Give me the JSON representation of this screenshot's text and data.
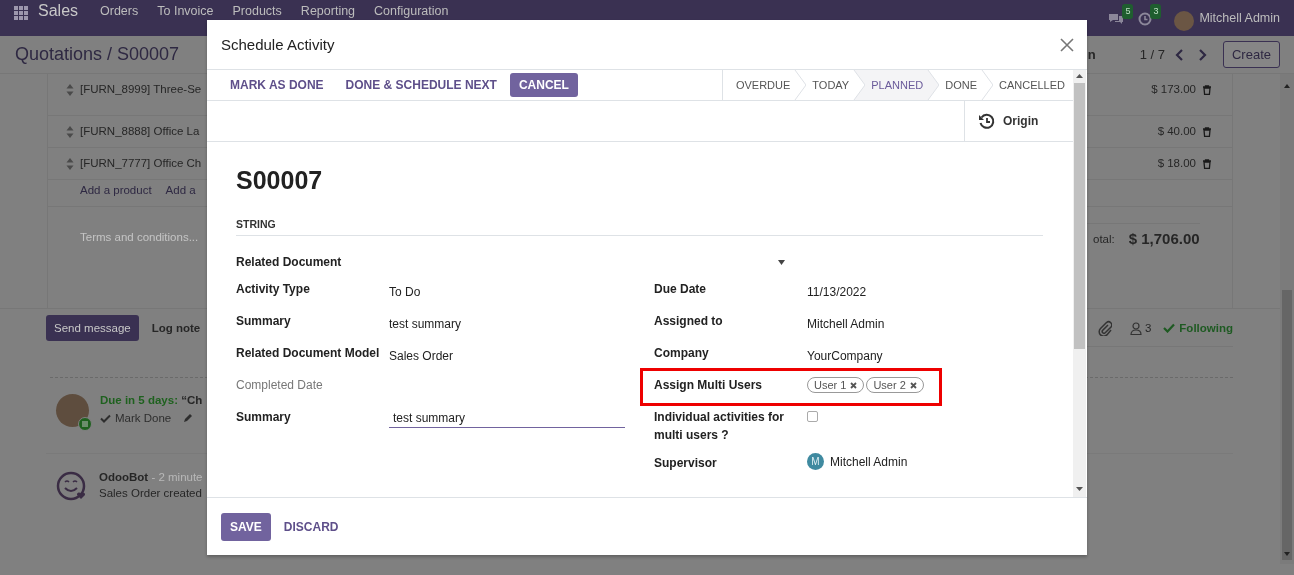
{
  "navbar": {
    "app": "Sales",
    "menu": [
      "Orders",
      "To Invoice",
      "Products",
      "Reporting",
      "Configuration"
    ],
    "messages_count": "5",
    "activities_count": "3",
    "user": "Mitchell Admin"
  },
  "control_panel": {
    "breadcrumb": "Quotations / S00007",
    "action_fragment": "n",
    "pager": "1 / 7",
    "create": "Create"
  },
  "order_lines": [
    {
      "product": "[FURN_8999] Three-Se",
      "amount": "$ 173.00"
    },
    {
      "product": "[FURN_8888] Office La",
      "amount": "$ 40.00"
    },
    {
      "product": "[FURN_7777] Office Ch",
      "amount": "$ 18.00"
    }
  ],
  "add_links": [
    "Add a product",
    "Add a"
  ],
  "terms_placeholder": "Terms and conditions...",
  "total": {
    "label": "otal:",
    "value": "$ 1,706.00"
  },
  "chatter": {
    "send": "Send message",
    "log": "Log note",
    "followers": "3",
    "following": "Following",
    "activity": {
      "due": "Due in 5 days:",
      "summary": "“Ch",
      "mark_done": "Mark Done"
    },
    "message": {
      "author": "OdooBot",
      "time": "- 2 minute",
      "body": "Sales Order created"
    }
  },
  "dialog": {
    "title": "Schedule Activity",
    "actions": [
      {
        "label": "MARK AS DONE",
        "kind": "link"
      },
      {
        "label": "DONE & SCHEDULE NEXT",
        "kind": "link"
      },
      {
        "label": "CANCEL",
        "kind": "primary"
      }
    ],
    "stages": [
      {
        "label": "OVERDUE",
        "selected": false
      },
      {
        "label": "TODAY",
        "selected": false
      },
      {
        "label": "PLANNED",
        "selected": true
      },
      {
        "label": "DONE",
        "selected": false
      },
      {
        "label": "CANCELLED",
        "selected": false
      }
    ],
    "smart_button": "Origin",
    "record_name": "S00007",
    "separator": "STRING",
    "related_document": {
      "label": "Related Document"
    },
    "left_fields": [
      {
        "kind": "text",
        "label": "Activity Type",
        "value": "To Do"
      },
      {
        "kind": "text",
        "label": "Summary",
        "value": "test summary"
      },
      {
        "kind": "text",
        "label": "Related Document Model",
        "value": "Sales Order"
      },
      {
        "kind": "readonly",
        "label": "Completed Date"
      },
      {
        "kind": "input",
        "label": "Summary",
        "value": "test summary"
      }
    ],
    "right_fields": [
      {
        "kind": "text",
        "label": "Due Date",
        "value": "11/13/2022"
      },
      {
        "kind": "text",
        "label": "Assigned to",
        "value": "Mitchell Admin"
      },
      {
        "kind": "text",
        "label": "Company",
        "value": "YourCompany"
      },
      {
        "kind": "tags",
        "label": "Assign Multi Users",
        "highlighted": true,
        "tags": [
          "User 1",
          "User 2"
        ]
      },
      {
        "kind": "checkbox",
        "label": "Individual activities for multi users ?",
        "checked": false
      },
      {
        "kind": "avatar",
        "label": "Supervisor",
        "initial": "M",
        "value": "Mitchell Admin"
      }
    ],
    "footer": [
      {
        "label": "SAVE",
        "kind": "primary"
      },
      {
        "label": "DISCARD",
        "kind": "link"
      }
    ]
  }
}
